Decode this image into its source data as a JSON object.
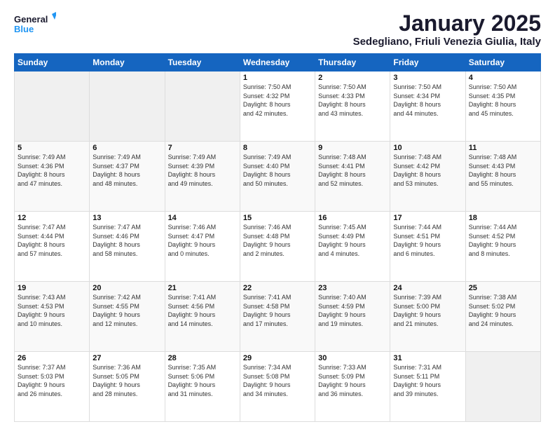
{
  "logo": {
    "line1": "General",
    "line2": "Blue"
  },
  "title": "January 2025",
  "subtitle": "Sedegliano, Friuli Venezia Giulia, Italy",
  "days_header": [
    "Sunday",
    "Monday",
    "Tuesday",
    "Wednesday",
    "Thursday",
    "Friday",
    "Saturday"
  ],
  "weeks": [
    [
      {
        "num": "",
        "info": ""
      },
      {
        "num": "",
        "info": ""
      },
      {
        "num": "",
        "info": ""
      },
      {
        "num": "1",
        "info": "Sunrise: 7:50 AM\nSunset: 4:32 PM\nDaylight: 8 hours\nand 42 minutes."
      },
      {
        "num": "2",
        "info": "Sunrise: 7:50 AM\nSunset: 4:33 PM\nDaylight: 8 hours\nand 43 minutes."
      },
      {
        "num": "3",
        "info": "Sunrise: 7:50 AM\nSunset: 4:34 PM\nDaylight: 8 hours\nand 44 minutes."
      },
      {
        "num": "4",
        "info": "Sunrise: 7:50 AM\nSunset: 4:35 PM\nDaylight: 8 hours\nand 45 minutes."
      }
    ],
    [
      {
        "num": "5",
        "info": "Sunrise: 7:49 AM\nSunset: 4:36 PM\nDaylight: 8 hours\nand 47 minutes."
      },
      {
        "num": "6",
        "info": "Sunrise: 7:49 AM\nSunset: 4:37 PM\nDaylight: 8 hours\nand 48 minutes."
      },
      {
        "num": "7",
        "info": "Sunrise: 7:49 AM\nSunset: 4:39 PM\nDaylight: 8 hours\nand 49 minutes."
      },
      {
        "num": "8",
        "info": "Sunrise: 7:49 AM\nSunset: 4:40 PM\nDaylight: 8 hours\nand 50 minutes."
      },
      {
        "num": "9",
        "info": "Sunrise: 7:48 AM\nSunset: 4:41 PM\nDaylight: 8 hours\nand 52 minutes."
      },
      {
        "num": "10",
        "info": "Sunrise: 7:48 AM\nSunset: 4:42 PM\nDaylight: 8 hours\nand 53 minutes."
      },
      {
        "num": "11",
        "info": "Sunrise: 7:48 AM\nSunset: 4:43 PM\nDaylight: 8 hours\nand 55 minutes."
      }
    ],
    [
      {
        "num": "12",
        "info": "Sunrise: 7:47 AM\nSunset: 4:44 PM\nDaylight: 8 hours\nand 57 minutes."
      },
      {
        "num": "13",
        "info": "Sunrise: 7:47 AM\nSunset: 4:46 PM\nDaylight: 8 hours\nand 58 minutes."
      },
      {
        "num": "14",
        "info": "Sunrise: 7:46 AM\nSunset: 4:47 PM\nDaylight: 9 hours\nand 0 minutes."
      },
      {
        "num": "15",
        "info": "Sunrise: 7:46 AM\nSunset: 4:48 PM\nDaylight: 9 hours\nand 2 minutes."
      },
      {
        "num": "16",
        "info": "Sunrise: 7:45 AM\nSunset: 4:49 PM\nDaylight: 9 hours\nand 4 minutes."
      },
      {
        "num": "17",
        "info": "Sunrise: 7:44 AM\nSunset: 4:51 PM\nDaylight: 9 hours\nand 6 minutes."
      },
      {
        "num": "18",
        "info": "Sunrise: 7:44 AM\nSunset: 4:52 PM\nDaylight: 9 hours\nand 8 minutes."
      }
    ],
    [
      {
        "num": "19",
        "info": "Sunrise: 7:43 AM\nSunset: 4:53 PM\nDaylight: 9 hours\nand 10 minutes."
      },
      {
        "num": "20",
        "info": "Sunrise: 7:42 AM\nSunset: 4:55 PM\nDaylight: 9 hours\nand 12 minutes."
      },
      {
        "num": "21",
        "info": "Sunrise: 7:41 AM\nSunset: 4:56 PM\nDaylight: 9 hours\nand 14 minutes."
      },
      {
        "num": "22",
        "info": "Sunrise: 7:41 AM\nSunset: 4:58 PM\nDaylight: 9 hours\nand 17 minutes."
      },
      {
        "num": "23",
        "info": "Sunrise: 7:40 AM\nSunset: 4:59 PM\nDaylight: 9 hours\nand 19 minutes."
      },
      {
        "num": "24",
        "info": "Sunrise: 7:39 AM\nSunset: 5:00 PM\nDaylight: 9 hours\nand 21 minutes."
      },
      {
        "num": "25",
        "info": "Sunrise: 7:38 AM\nSunset: 5:02 PM\nDaylight: 9 hours\nand 24 minutes."
      }
    ],
    [
      {
        "num": "26",
        "info": "Sunrise: 7:37 AM\nSunset: 5:03 PM\nDaylight: 9 hours\nand 26 minutes."
      },
      {
        "num": "27",
        "info": "Sunrise: 7:36 AM\nSunset: 5:05 PM\nDaylight: 9 hours\nand 28 minutes."
      },
      {
        "num": "28",
        "info": "Sunrise: 7:35 AM\nSunset: 5:06 PM\nDaylight: 9 hours\nand 31 minutes."
      },
      {
        "num": "29",
        "info": "Sunrise: 7:34 AM\nSunset: 5:08 PM\nDaylight: 9 hours\nand 34 minutes."
      },
      {
        "num": "30",
        "info": "Sunrise: 7:33 AM\nSunset: 5:09 PM\nDaylight: 9 hours\nand 36 minutes."
      },
      {
        "num": "31",
        "info": "Sunrise: 7:31 AM\nSunset: 5:11 PM\nDaylight: 9 hours\nand 39 minutes."
      },
      {
        "num": "",
        "info": ""
      }
    ]
  ]
}
